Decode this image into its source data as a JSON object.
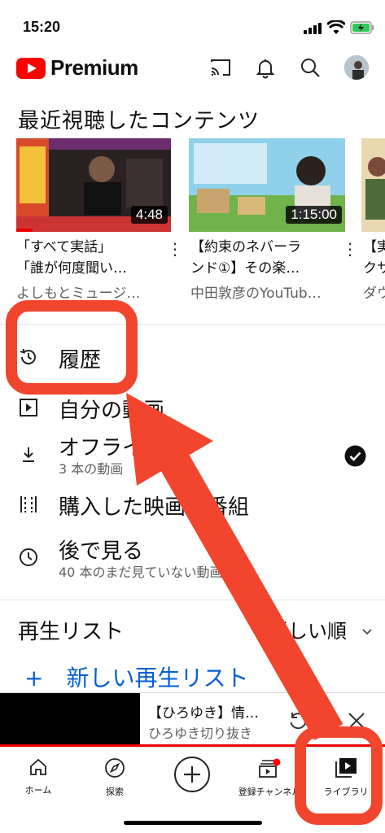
{
  "status": {
    "time": "15:20"
  },
  "header": {
    "brand": "Premium"
  },
  "recent": {
    "title": "最近視聴したコンテンツ",
    "videos": [
      {
        "title_line1": "「すべて実話」",
        "title_line2": "「誰が何度聞い…",
        "channel": "よしもとミュージ…",
        "duration": "4:48"
      },
      {
        "title_line1": "【約束のネバーラ",
        "title_line2": "ンド①】その楽…",
        "channel": "中田敦彦のYouTub…",
        "duration": "1:15:00"
      },
      {
        "title_line1": "【実",
        "title_line2": "クサ",
        "channel": "ダウ"
      }
    ]
  },
  "menu": {
    "history": "履歴",
    "my_videos": "自分の動画",
    "offline": "オフライン",
    "offline_sub": "3 本の動画",
    "purchases": "購入した映画と番組",
    "watch_later": "後で見る",
    "watch_later_sub": "40 本のまだ見ていない動画"
  },
  "playlists": {
    "title": "再生リスト",
    "sort": "新しい順",
    "new_playlist": "新しい再生リスト"
  },
  "mini_player": {
    "title": "【ひろゆき】情…",
    "channel": "ひろゆき切り抜き"
  },
  "nav": {
    "home": "ホーム",
    "explore": "探索",
    "subscriptions": "登録チャンネル",
    "library": "ライブラリ"
  },
  "colors": {
    "brand_red": "#ff0000",
    "annotation_red": "#f2452e",
    "link_blue": "#065fd4"
  }
}
